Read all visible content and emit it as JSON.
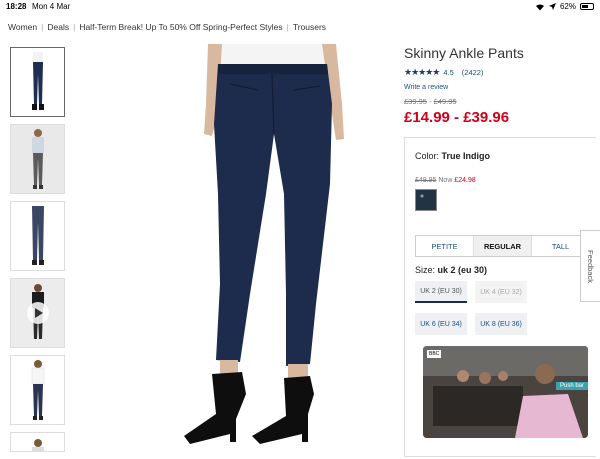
{
  "status": {
    "time": "18:28",
    "date": "Mon 4 Mar",
    "battery": "62%",
    "battery_level": 0.62
  },
  "breadcrumb": [
    "Women",
    "Deals",
    "Half-Term Break! Up To 50% Off Spring-Perfect Styles",
    "Trousers"
  ],
  "product": {
    "title": "Skinny Ankle Pants",
    "rating_stars": 4.5,
    "rating_text": "4.5",
    "review_count": "(2422)",
    "write_review": "Write a review",
    "old_price_1": "£39.95",
    "old_price_sep": " - ",
    "old_price_2": "£49.95",
    "price": "£14.99 - £39.96"
  },
  "color": {
    "label": "Color:",
    "name": "True Indigo",
    "was": "£49.95",
    "now_label": "Now",
    "now_price": "£24.98"
  },
  "fits": [
    {
      "label": "PETITE",
      "active": false
    },
    {
      "label": "REGULAR",
      "active": true
    },
    {
      "label": "TALL",
      "active": false
    }
  ],
  "size": {
    "label": "Size:",
    "value": "uk 2 (eu 30)",
    "options": [
      {
        "label": "UK 2 (EU 30)",
        "state": "selected"
      },
      {
        "label": "UK 4 (EU 32)",
        "state": "disabled"
      },
      {
        "label": "UK 6 (EU 34)",
        "state": "available"
      },
      {
        "label": "UK 8 (EU 36)",
        "state": "available"
      }
    ]
  },
  "feedback": "Feedback",
  "video": {
    "channel": "BBC",
    "overlay": "Push bar"
  },
  "colors": {
    "price_red": "#d0001b",
    "link_blue": "#1a4f8b",
    "star_navy": "#1a3a6b"
  },
  "icons": [
    "wifi-icon",
    "location-icon",
    "battery-icon",
    "star-icon",
    "play-icon"
  ]
}
